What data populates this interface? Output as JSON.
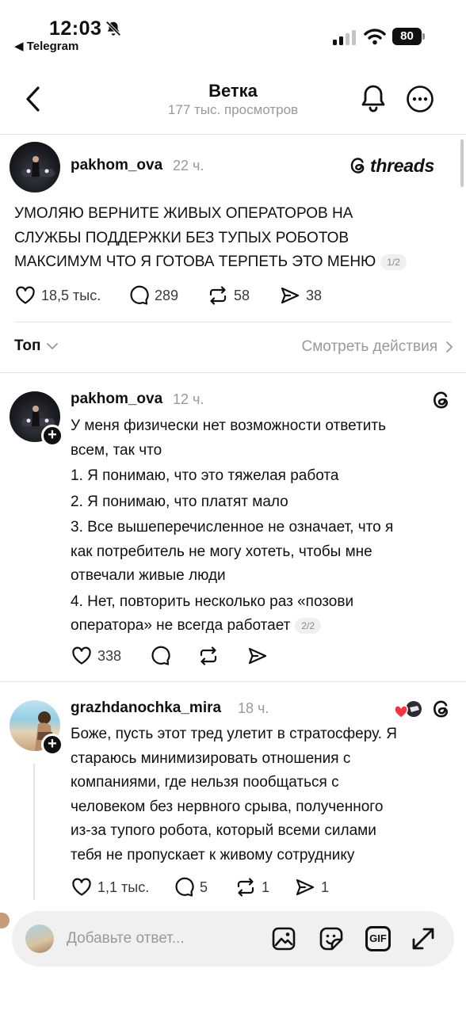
{
  "status_bar": {
    "time": "12:03",
    "back_app": "◀ Telegram",
    "battery": "80"
  },
  "header": {
    "title": "Ветка",
    "subtitle": "177 тыс. просмотров"
  },
  "main_post": {
    "username": "pakhom_ova",
    "time": "22 ч.",
    "brand": "threads",
    "text_lines": [
      "УМОЛЯЮ ВЕРНИТЕ ЖИВЫХ ОПЕРАТОРОВ НА",
      "СЛУЖБЫ ПОДДЕРЖКИ БЕЗ ТУПЫХ РОБОТОВ",
      "МАКСИМУМ ЧТО Я ГОТОВА ТЕРПЕТЬ ЭТО МЕНЮ"
    ],
    "pager": "1/2",
    "likes": "18,5 тыс.",
    "comments": "289",
    "reposts": "58",
    "shares": "38"
  },
  "sort": {
    "label": "Топ",
    "see_actions": "Смотреть действия"
  },
  "reply1": {
    "username": "pakhom_ova",
    "time": "12 ч.",
    "text_lines": [
      "У меня физически нет возможности ответить",
      "всем, так что",
      "1. Я понимаю, что это тяжелая работа",
      "2. Я понимаю, что платят мало",
      "3. Все вышеперечисленное не означает, что я",
      "как потребитель не могу хотеть, чтобы мне",
      "отвечали живые люди",
      "4. Нет, повторить несколько раз «позови",
      "оператора» не всегда работает"
    ],
    "pager": "2/2",
    "likes": "338"
  },
  "reply2": {
    "username": "grazhdanochka_mira",
    "time": "18 ч.",
    "text_lines": [
      "Боже, пусть этот тред улетит в стратосферу. Я",
      "стараюсь минимизировать отношения с",
      "компаниями, где нельзя пообщаться с",
      "человеком без нервного срыва, полученного",
      "из-за тупого робота, который всеми силами",
      "тебя не пропускает к живому сотруднику"
    ],
    "likes": "1,1 тыс.",
    "comments": "5",
    "reposts": "1",
    "shares": "1"
  },
  "composer": {
    "placeholder": "Добавьте ответ...",
    "gif_label": "GIF"
  },
  "colors": {
    "text": "#101010",
    "muted": "#999999",
    "like_red": "#ff3040",
    "surface": "#f0f0f0"
  },
  "icons": [
    "bell-off-icon",
    "signal-icon",
    "wifi-icon",
    "back-chevron-icon",
    "bell-icon",
    "more-icon",
    "threads-logo-icon",
    "heart-icon",
    "comment-icon",
    "repost-icon",
    "share-icon",
    "chevron-down-icon",
    "chevron-right-icon",
    "image-icon",
    "sticker-icon",
    "gif-icon",
    "expand-icon"
  ]
}
